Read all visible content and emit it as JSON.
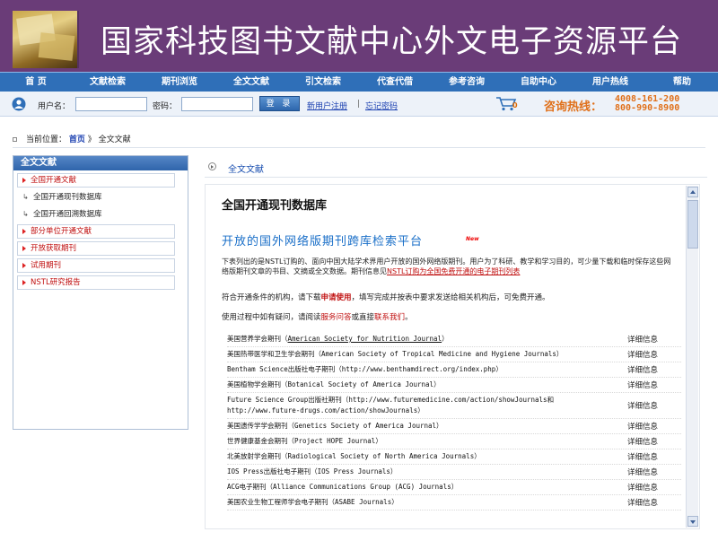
{
  "header": {
    "site_title": "国家科技图书文献中心外文电子资源平台"
  },
  "nav": {
    "items": [
      "首 页",
      "文献检索",
      "期刊浏览",
      "全文文献",
      "引文检索",
      "代查代借",
      "参考咨询",
      "自助中心",
      "用户热线",
      "帮助"
    ]
  },
  "login": {
    "username_label": "用户名：",
    "username_value": "",
    "password_label": "密码：",
    "password_value": "",
    "submit_label": "登 录",
    "register_link": "新用户注册",
    "separator": "|",
    "forgot_link": "忘记密码",
    "cart_count": "0",
    "hotline_label": "咨询热线：",
    "hotline_1": "4008-161-200",
    "hotline_2": "800-990-8900"
  },
  "breadcrumb": {
    "prefix": "当前位置：",
    "home": "首页",
    "separator": "》",
    "current": "全文文献"
  },
  "sidebar": {
    "title": "全文文献",
    "items": [
      {
        "label": "全国开通文献",
        "style": "red"
      },
      {
        "label": "全国开通现刊数据库",
        "style": "sub"
      },
      {
        "label": "全国开通回溯数据库",
        "style": "sub"
      },
      {
        "label": "部分单位开通文献",
        "style": "red"
      },
      {
        "label": "开放获取期刊",
        "style": "red"
      },
      {
        "label": "试用期刊",
        "style": "red"
      },
      {
        "label": "NSTL研究报告",
        "style": "red"
      }
    ]
  },
  "main": {
    "section_title": "全文文献",
    "heading": "全国开通现刊数据库",
    "subheading": "开放的国外网络版期刊跨库检索平台",
    "new_badge": "New",
    "intro_a": "下表列出的是NSTL订购的、面向中国大陆学术界用户开放的国外网络版期刊。用户为了科研、教学和学习目的，可少量下载和临时保存这些网络版期刊文章的书目、文摘或全文数据。期刊信息见",
    "intro_link": "NSTL订购为全国免费开通的电子期刊列表",
    "condition_a": "符合开通条件的机构，请下载",
    "condition_link": "申请使用",
    "condition_b": "，填写完成并按表中要求发送给相关机构后，可免费开通。",
    "help_a": "使用过程中如有疑问，请阅读",
    "help_link_1": "服务问答",
    "help_b": "或直接",
    "help_link_2": "联系我们",
    "help_c": "。",
    "detail_label": "详细信息",
    "journals": [
      {
        "pre": "美国营养学会期刊（",
        "name": "American Society for Nutrition Journal",
        "post": "）",
        "underline": true
      },
      {
        "pre": "美国热带医学和卫生学会期刊（",
        "name": "American Society of Tropical Medicine and Hygiene Journals",
        "post": "）",
        "underline": false
      },
      {
        "pre": "Bentham Science出版社电子期刊（",
        "name": "http://www.benthamdirect.org/index.php",
        "post": "）",
        "underline": false
      },
      {
        "pre": "美国植物学会期刊（",
        "name": "Botanical Society of America Journal",
        "post": "）",
        "underline": false
      },
      {
        "pre": "Future Science Group出版社期刊（",
        "name": "http://www.futuremedicine.com/action/showJournals和http://www.future-drugs.com/action/showJournals",
        "post": "）",
        "underline": false
      },
      {
        "pre": "美国遗传学学会期刊（",
        "name": "Genetics Society of America Journal",
        "post": "）",
        "underline": false
      },
      {
        "pre": "世界健康基金会期刊（",
        "name": "Project HOPE Journal",
        "post": "）",
        "underline": false
      },
      {
        "pre": "北美放射学会期刊（",
        "name": "Radiological Society of North America Journals",
        "post": "）",
        "underline": false
      },
      {
        "pre": "IOS Press出版社电子期刊（",
        "name": "IOS Press Journals",
        "post": "）",
        "underline": false
      },
      {
        "pre": "ACG电子期刊（",
        "name": "Alliance Communications Group (ACG) Journals",
        "post": "）",
        "underline": false
      },
      {
        "pre": "美国农业生物工程师学会电子期刊（",
        "name": "ASABE Journals",
        "post": "）",
        "underline": false
      }
    ]
  },
  "colors": {
    "banner": "#6a3c78",
    "nav": "#2f6fb8",
    "hotline": "#e0701a",
    "link_red": "#c01010"
  }
}
